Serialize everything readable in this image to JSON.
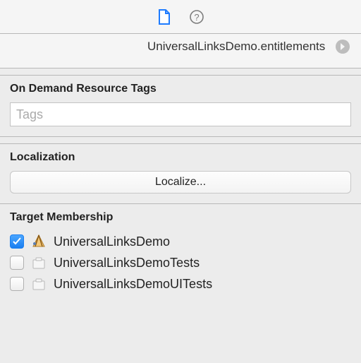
{
  "identity": {
    "file_name": "UniversalLinksDemo.entitlements"
  },
  "resource_tags": {
    "header": "On Demand Resource Tags",
    "placeholder": "Tags",
    "value": ""
  },
  "localization": {
    "header": "Localization",
    "button_label": "Localize..."
  },
  "target_membership": {
    "header": "Target Membership",
    "items": [
      {
        "label": "UniversalLinksDemo",
        "checked": true,
        "icon": "app"
      },
      {
        "label": "UniversalLinksDemoTests",
        "checked": false,
        "icon": "bundle"
      },
      {
        "label": "UniversalLinksDemoUITests",
        "checked": false,
        "icon": "bundle"
      }
    ]
  }
}
